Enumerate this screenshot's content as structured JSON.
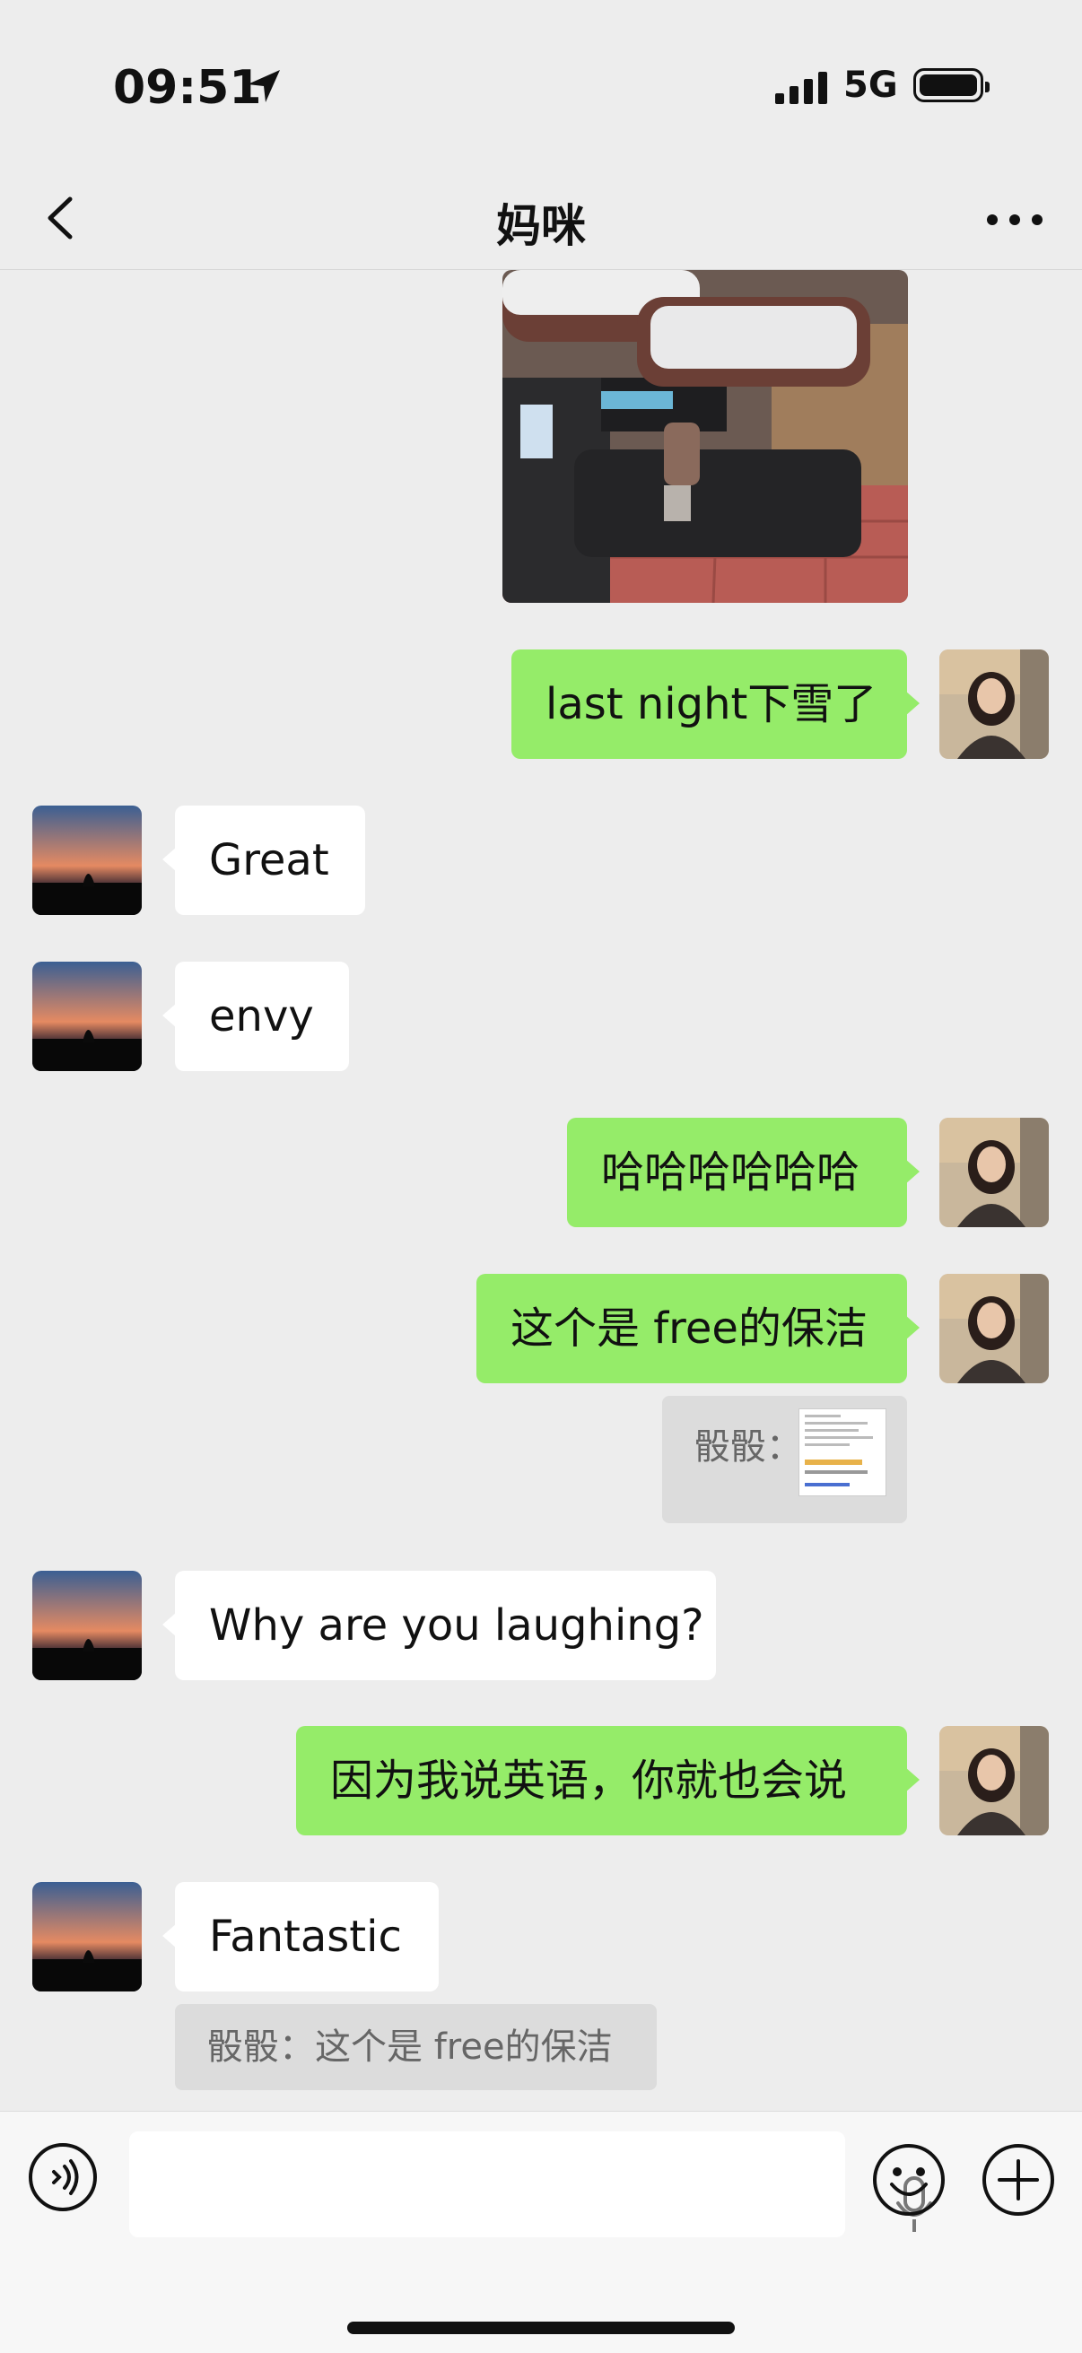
{
  "status_bar": {
    "time": "09:51",
    "network": "5G"
  },
  "header": {
    "title": "妈咪"
  },
  "messages": [
    {
      "sender": "me",
      "type": "image",
      "description": "scooter-with-snow"
    },
    {
      "sender": "me",
      "text": "last night下雪了"
    },
    {
      "sender": "them",
      "text": "Great"
    },
    {
      "sender": "them",
      "text": "envy"
    },
    {
      "sender": "me",
      "text": "哈哈哈哈哈哈"
    },
    {
      "sender": "me",
      "text": "这个是 free的保洁"
    },
    {
      "sender": "me",
      "type": "quote",
      "quote_author": "骰骰："
    },
    {
      "sender": "them",
      "text": "Why are you laughing?"
    },
    {
      "sender": "me",
      "text": "因为我说英语，你就也会说"
    },
    {
      "sender": "them",
      "text": "Fantastic"
    },
    {
      "sender": "them",
      "type": "quote",
      "text": "骰骰：这个是 free的保洁"
    }
  ],
  "colors": {
    "my_bubble": "#95ec69",
    "their_bubble": "#ffffff",
    "background": "#ededed"
  }
}
